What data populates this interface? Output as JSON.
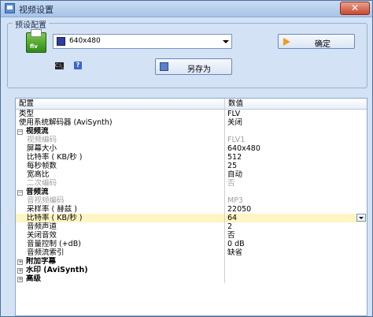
{
  "window": {
    "title": "视频设置",
    "icon": "app-icon",
    "close_label": "✕"
  },
  "preset": {
    "group_label": "预设配置",
    "selected": "640x480",
    "confirm_label": "确定",
    "saveas_label": "另存为",
    "cmd_icon_text": "C:\\_",
    "help_icon_text": "?"
  },
  "grid": {
    "header": {
      "name": "配置",
      "value": "数值"
    },
    "rows": [
      {
        "name": "类型",
        "value": "FLV"
      },
      {
        "name": "使用系统解码器 (AviSynth)",
        "value": "关闭"
      },
      {
        "name": "视频流",
        "toggle": "−"
      },
      {
        "name": "视频编码",
        "value": "FLV1"
      },
      {
        "name": "屏幕大小",
        "value": "640x480"
      },
      {
        "name": "比特率 ( KB/秒 )",
        "value": "512"
      },
      {
        "name": "每秒帧数",
        "value": "25"
      },
      {
        "name": "宽高比",
        "value": "自动"
      },
      {
        "name": "二次编码",
        "value": "否"
      },
      {
        "name": "音频流",
        "toggle": "−"
      },
      {
        "name": "音视频编码",
        "value": "MP3"
      },
      {
        "name": "采样率 ( 赫兹 )",
        "value": "22050"
      },
      {
        "name": "比特率 ( KB/秒 )",
        "value": "64"
      },
      {
        "name": "音频声道",
        "value": "2"
      },
      {
        "name": "关闭音效",
        "value": "否"
      },
      {
        "name": "音量控制 (+dB)",
        "value": "0 dB"
      },
      {
        "name": "音频流索引",
        "value": "缺省"
      },
      {
        "name": "附加字幕",
        "toggle": "+"
      },
      {
        "name": "水印 (AviSynth)",
        "toggle": "+"
      },
      {
        "name": "高级",
        "toggle": "+"
      }
    ]
  },
  "colors": {
    "window_bg": "#d3e2f4",
    "highlight": "#fff5c3",
    "accent": "#f09b1e"
  }
}
